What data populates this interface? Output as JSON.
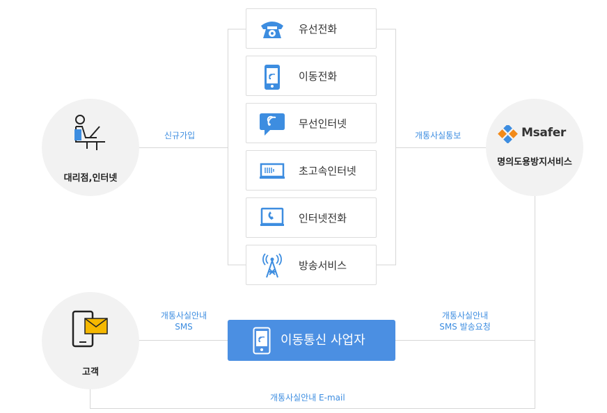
{
  "nodes": {
    "agency": "대리점,인터넷",
    "customer": "고객",
    "msafer_logo": "Msafer",
    "msafer_service": "명의도용방지서비스",
    "carrier": "이동통신 사업자"
  },
  "services": [
    {
      "label": "유선전화",
      "icon": "telephone-icon"
    },
    {
      "label": "이동전화",
      "icon": "mobile-phone-icon"
    },
    {
      "label": "무선인터넷",
      "icon": "wifi-bubble-icon"
    },
    {
      "label": "초고속인터넷",
      "icon": "modem-icon"
    },
    {
      "label": "인터넷전화",
      "icon": "internet-phone-icon"
    },
    {
      "label": "방송서비스",
      "icon": "broadcast-tower-icon"
    }
  ],
  "edges": {
    "signup": "신규가입",
    "notify": "개통사실통보",
    "sms_guide_line1": "개통사실안내",
    "sms_guide_line2": "SMS",
    "sms_request_line1": "개통사실안내",
    "sms_request_line2": "SMS 발송요청",
    "email_guide": "개통사실안내 E-mail"
  },
  "colors": {
    "blue": "#4b8fe2",
    "label_blue": "#3d8de0",
    "circle": "#f2f2f2",
    "line": "#d6d6d6",
    "icon_blue": "#3d8de0",
    "envelope": "#f5b800"
  }
}
